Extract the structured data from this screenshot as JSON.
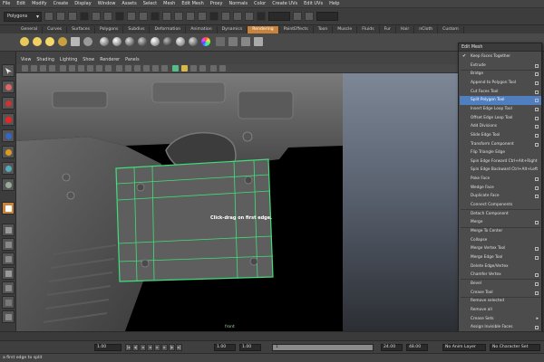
{
  "menubar": {
    "items": [
      "File",
      "Edit",
      "Modify",
      "Create",
      "Display",
      "Window",
      "Assets",
      "Select",
      "Mesh",
      "Edit Mesh",
      "Proxy",
      "Normals",
      "Color",
      "Create UVs",
      "Edit UVs",
      "Help"
    ]
  },
  "statusline": {
    "mode": "Polygons"
  },
  "shelf": {
    "tabs": [
      "General",
      "Curves",
      "Surfaces",
      "Polygons",
      "Subdivs",
      "Deformation",
      "Animation",
      "Dynamics",
      "Rendering",
      "PaintEffects",
      "Toon",
      "Muscle",
      "Fluids",
      "Fur",
      "Hair",
      "nCloth",
      "Custom"
    ],
    "active_tab": "Rendering"
  },
  "panel": {
    "menus": [
      "View",
      "Shading",
      "Lighting",
      "Show",
      "Renderer",
      "Panels"
    ]
  },
  "viewport": {
    "hint": "Click-drag on first edge.",
    "camera_label": "front"
  },
  "edit_mesh_menu": {
    "title": "Edit Mesh",
    "items": [
      {
        "label": "Keep Faces Together",
        "checked": true,
        "option_box": false,
        "submenu": false
      },
      {
        "label": "Extrude",
        "checked": false,
        "option_box": true,
        "submenu": false
      },
      {
        "label": "Bridge",
        "checked": false,
        "option_box": true,
        "submenu": false
      },
      {
        "label": "Append to Polygon Tool",
        "checked": false,
        "option_box": true,
        "submenu": false
      },
      {
        "label": "Cut Faces Tool",
        "checked": false,
        "option_box": true,
        "submenu": false
      },
      {
        "label": "Split Polygon Tool",
        "checked": false,
        "option_box": true,
        "submenu": false,
        "highlighted": true
      },
      {
        "label": "Insert Edge Loop Tool",
        "checked": false,
        "option_box": true,
        "submenu": false
      },
      {
        "label": "Offset Edge Loop Tool",
        "checked": false,
        "option_box": true,
        "submenu": false
      },
      {
        "label": "Add Divisions",
        "checked": false,
        "option_box": true,
        "submenu": false
      },
      {
        "label": "Slide Edge Tool",
        "checked": false,
        "option_box": true,
        "submenu": false
      },
      {
        "label": "Transform Component",
        "checked": false,
        "option_box": true,
        "submenu": false
      },
      {
        "label": "Flip Triangle Edge",
        "checked": false,
        "option_box": false,
        "submenu": false
      },
      {
        "label": "Spin Edge Forward  Ctrl+Alt+Right",
        "checked": false,
        "option_box": false,
        "submenu": false
      },
      {
        "label": "Spin Edge Backward  Ctrl+Alt+Left",
        "checked": false,
        "option_box": false,
        "submenu": false
      },
      {
        "label": "Poke Face",
        "checked": false,
        "option_box": true,
        "submenu": false
      },
      {
        "label": "Wedge Face",
        "checked": false,
        "option_box": true,
        "submenu": false
      },
      {
        "label": "Duplicate Face",
        "checked": false,
        "option_box": true,
        "submenu": false
      },
      {
        "label": "Connect Components",
        "checked": false,
        "option_box": false,
        "submenu": false
      },
      {
        "label": "Detach Component",
        "checked": false,
        "option_box": false,
        "submenu": false
      },
      {
        "label": "Merge",
        "checked": false,
        "option_box": true,
        "submenu": false
      },
      {
        "label": "Merge To Center",
        "checked": false,
        "option_box": false,
        "submenu": false
      },
      {
        "label": "Collapse",
        "checked": false,
        "option_box": false,
        "submenu": false
      },
      {
        "label": "Merge Vertex Tool",
        "checked": false,
        "option_box": true,
        "submenu": false
      },
      {
        "label": "Merge Edge Tool",
        "checked": false,
        "option_box": true,
        "submenu": false
      },
      {
        "label": "Delete Edge/Vertex",
        "checked": false,
        "option_box": false,
        "submenu": false
      },
      {
        "label": "Chamfer Vertex",
        "checked": false,
        "option_box": true,
        "submenu": false
      },
      {
        "label": "Bevel",
        "checked": false,
        "option_box": true,
        "submenu": false
      },
      {
        "label": "Crease Tool",
        "checked": false,
        "option_box": true,
        "submenu": false
      },
      {
        "label": "Remove selected",
        "checked": false,
        "option_box": false,
        "submenu": false
      },
      {
        "label": "Remove all",
        "checked": false,
        "option_box": false,
        "submenu": false
      },
      {
        "label": "Crease Sets",
        "checked": false,
        "option_box": false,
        "submenu": true
      },
      {
        "label": "Assign Invisible Faces",
        "checked": false,
        "option_box": true,
        "submenu": false
      }
    ]
  },
  "range": {
    "start_field": "1.00",
    "current_field": "1.00",
    "range_start": "1.00",
    "slider_value": "1",
    "range_end": "24.00",
    "end_field": "48.00",
    "anim_layer": "No Anim Layer",
    "char_set": "No Character Set"
  },
  "helpline": {
    "text": "a first edge to split"
  },
  "colors": {
    "highlight": "#4f7fbf",
    "active_tab": "#c9833a",
    "wireframe": "#3fe07a"
  }
}
